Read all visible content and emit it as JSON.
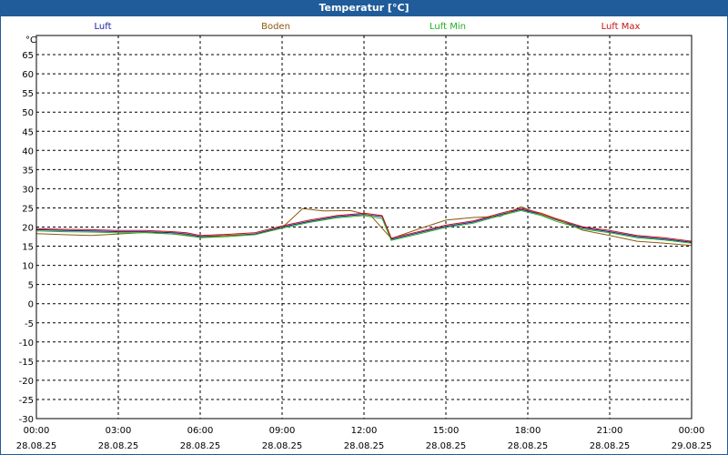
{
  "window": {
    "title": "Temperatur [°C]"
  },
  "chart_data": {
    "type": "line",
    "ylabel": "°C",
    "ylim": [
      -30,
      70
    ],
    "yticks": [
      65,
      60,
      55,
      50,
      45,
      40,
      35,
      30,
      25,
      20,
      15,
      10,
      5,
      0,
      -5,
      -10,
      -15,
      -20,
      -25,
      -30
    ],
    "xlim": [
      "2025-08-28 00:00",
      "2025-08-29 00:00"
    ],
    "xticks": [
      {
        "time": "00:00",
        "date": "28.08.25"
      },
      {
        "time": "03:00",
        "date": "28.08.25"
      },
      {
        "time": "06:00",
        "date": "28.08.25"
      },
      {
        "time": "09:00",
        "date": "28.08.25"
      },
      {
        "time": "12:00",
        "date": "28.08.25"
      },
      {
        "time": "15:00",
        "date": "28.08.25"
      },
      {
        "time": "18:00",
        "date": "28.08.25"
      },
      {
        "time": "21:00",
        "date": "28.08.25"
      },
      {
        "time": "00:00",
        "date": "29.08.25"
      }
    ],
    "grid": true,
    "legend_position": "top",
    "series": [
      {
        "name": "Luft",
        "color": "#1a1aa6",
        "x": [
          "2025-08-28 00:00",
          "2025-08-28 01:00",
          "2025-08-28 02:00",
          "2025-08-28 03:00",
          "2025-08-28 04:00",
          "2025-08-28 05:00",
          "2025-08-28 05:30",
          "2025-08-28 06:00",
          "2025-08-28 07:00",
          "2025-08-28 08:00",
          "2025-08-28 09:00",
          "2025-08-28 10:00",
          "2025-08-28 11:00",
          "2025-08-28 12:00",
          "2025-08-28 12:40",
          "2025-08-28 13:00",
          "2025-08-28 14:00",
          "2025-08-28 15:00",
          "2025-08-28 16:00",
          "2025-08-28 17:00",
          "2025-08-28 17:45",
          "2025-08-28 18:30",
          "2025-08-28 19:00",
          "2025-08-28 20:00",
          "2025-08-28 21:00",
          "2025-08-28 22:00",
          "2025-08-28 23:00",
          "2025-08-29 00:00"
        ],
        "y": [
          19.3,
          19.1,
          19.0,
          18.8,
          18.8,
          18.5,
          18.2,
          17.5,
          17.8,
          18.2,
          20.0,
          21.5,
          22.7,
          23.3,
          22.7,
          16.8,
          18.5,
          20.2,
          21.3,
          23.3,
          24.6,
          23.3,
          22.0,
          19.8,
          18.8,
          17.5,
          16.9,
          16.0
        ]
      },
      {
        "name": "Boden",
        "color": "#8b5a10",
        "x": [
          "2025-08-28 00:00",
          "2025-08-28 01:00",
          "2025-08-28 02:00",
          "2025-08-28 03:00",
          "2025-08-28 04:00",
          "2025-08-28 05:00",
          "2025-08-28 06:00",
          "2025-08-28 07:00",
          "2025-08-28 08:00",
          "2025-08-28 09:00",
          "2025-08-28 09:45",
          "2025-08-28 10:30",
          "2025-08-28 11:30",
          "2025-08-28 12:15",
          "2025-08-28 13:00",
          "2025-08-28 14:00",
          "2025-08-28 15:00",
          "2025-08-28 16:00",
          "2025-08-28 17:00",
          "2025-08-28 17:45",
          "2025-08-28 18:30",
          "2025-08-28 19:15",
          "2025-08-28 20:00",
          "2025-08-28 21:00",
          "2025-08-28 22:00",
          "2025-08-28 23:00",
          "2025-08-29 00:00"
        ],
        "y": [
          18.3,
          18.0,
          17.8,
          18.2,
          18.6,
          18.2,
          17.3,
          17.8,
          18.0,
          19.8,
          24.8,
          24.2,
          24.3,
          23.0,
          17.0,
          19.5,
          21.8,
          22.5,
          22.8,
          25.3,
          23.3,
          21.5,
          19.2,
          17.8,
          16.3,
          15.8,
          15.2
        ]
      },
      {
        "name": "Luft Min",
        "color": "#22b222",
        "x": [
          "2025-08-28 00:00",
          "2025-08-28 01:00",
          "2025-08-28 02:00",
          "2025-08-28 03:00",
          "2025-08-28 04:00",
          "2025-08-28 05:00",
          "2025-08-28 05:30",
          "2025-08-28 06:00",
          "2025-08-28 07:00",
          "2025-08-28 08:00",
          "2025-08-28 09:00",
          "2025-08-28 10:00",
          "2025-08-28 11:00",
          "2025-08-28 12:00",
          "2025-08-28 12:40",
          "2025-08-28 13:00",
          "2025-08-28 14:00",
          "2025-08-28 15:00",
          "2025-08-28 16:00",
          "2025-08-28 17:00",
          "2025-08-28 17:45",
          "2025-08-28 18:30",
          "2025-08-28 19:00",
          "2025-08-28 20:00",
          "2025-08-28 21:00",
          "2025-08-28 22:00",
          "2025-08-28 23:00",
          "2025-08-29 00:00"
        ],
        "y": [
          19.0,
          18.8,
          18.7,
          18.5,
          18.5,
          18.2,
          17.9,
          17.2,
          17.5,
          18.0,
          19.7,
          21.2,
          22.4,
          23.0,
          22.2,
          16.5,
          18.2,
          19.9,
          21.0,
          23.0,
          24.3,
          23.0,
          21.6,
          19.5,
          18.5,
          17.2,
          16.6,
          15.8
        ]
      },
      {
        "name": "Luft Max",
        "color": "#c81414",
        "x": [
          "2025-08-28 00:00",
          "2025-08-28 01:00",
          "2025-08-28 02:00",
          "2025-08-28 03:00",
          "2025-08-28 04:00",
          "2025-08-28 05:00",
          "2025-08-28 05:30",
          "2025-08-28 06:00",
          "2025-08-28 07:00",
          "2025-08-28 08:00",
          "2025-08-28 09:00",
          "2025-08-28 10:00",
          "2025-08-28 11:00",
          "2025-08-28 12:00",
          "2025-08-28 12:40",
          "2025-08-28 13:00",
          "2025-08-28 14:00",
          "2025-08-28 15:00",
          "2025-08-28 16:00",
          "2025-08-28 17:00",
          "2025-08-28 17:45",
          "2025-08-28 18:30",
          "2025-08-28 19:00",
          "2025-08-28 20:00",
          "2025-08-28 21:00",
          "2025-08-28 22:00",
          "2025-08-28 23:00",
          "2025-08-29 00:00"
        ],
        "y": [
          19.6,
          19.4,
          19.3,
          19.1,
          19.1,
          18.8,
          18.5,
          17.8,
          18.1,
          18.5,
          20.3,
          21.8,
          23.0,
          23.6,
          23.0,
          17.1,
          18.8,
          20.5,
          21.6,
          23.6,
          24.9,
          23.6,
          22.3,
          20.1,
          19.1,
          17.8,
          17.2,
          16.3
        ]
      }
    ]
  }
}
